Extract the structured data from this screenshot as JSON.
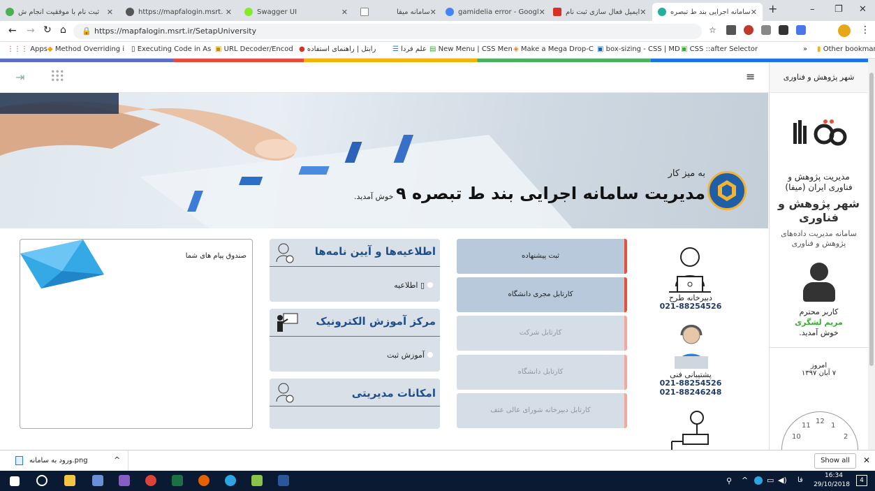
{
  "browser": {
    "tabs": [
      "ثبت نام با موفقیت انجام ش",
      "https://mapfalogin.msrt.",
      "Swagger UI",
      "",
      "سامانه میفا",
      "gamidelia error - Googl",
      "ایمیل فعال سازی ثبت نام",
      "سامانه اجرایی بند ط تبصره"
    ],
    "url": "https://mapfalogin.msrt.ir/SetapUniversity",
    "bookmarks": [
      "Apps",
      "Method Overriding i",
      "Executing Code in As",
      "URL Decoder/Encod",
      "رابتل | راهنمای استفاده",
      "علم فردا",
      "New Menu | CSS Men",
      "Make a Mega Drop-C",
      "box-sizing - CSS | MD",
      "CSS ::after Selector",
      "»",
      "Other bookmarks"
    ]
  },
  "sidebar": {
    "header": "شهر پژوهش و فناوری",
    "org": "مدیریت پژوهش و فناوری ایران (میفا)",
    "city": "شهر پژوهش و فناوری",
    "system": "سامانه مدیریت داده‌های پژوهش و فناوری",
    "user_greeting": "کاربر محترم",
    "user_name": "مریم لشگری",
    "welcome": "خوش آمدید.",
    "today_label": "امروز",
    "date": "۷ آبان ۱۳۹۷",
    "clock": {
      "n12": "12",
      "n1": "1",
      "n2": "2",
      "n10": "10",
      "n11": "11"
    }
  },
  "hero": {
    "to_desk": "به میز کار",
    "title": "مدیریت سامانه اجرایی بند ط تبصره ۹",
    "welcome": "خوش آمدید."
  },
  "contacts": [
    {
      "label": "دبیرخانه طرح",
      "phone": "021-88254526"
    },
    {
      "label": "پشتیبانی فنی",
      "phone": "021-88254526",
      "phone2": "021-88246248"
    }
  ],
  "menu": [
    {
      "label": "ثبت پیشنهاده",
      "enabled": true
    },
    {
      "label": "کارتابل مجری دانشگاه",
      "enabled": true
    },
    {
      "label": "کارتابل شرکت",
      "enabled": false
    },
    {
      "label": "کارتابل دانشگاه",
      "enabled": false
    },
    {
      "label": "کارتابل دبیرخانه شورای عالی عتف",
      "enabled": false
    }
  ],
  "news": {
    "title": "اطلاعیه‌ها و آیین نامه‌ها",
    "item": "اطلاعیه"
  },
  "elearning": {
    "title": "مرکز آموزش الکترونیک",
    "item": "آموزش ثبت"
  },
  "admin": {
    "title": "امکانات مدیریتی"
  },
  "inbox": {
    "title": "صندوق پیام های شما"
  },
  "downloads": {
    "file": "ورود به سامانه.png",
    "show_all": "Show all"
  },
  "taskbar": {
    "time": "16:34",
    "date": "29/10/2018",
    "lang": "فا"
  },
  "colors": {
    "accent": "#e2533d",
    "active_btn": "#b7c9da",
    "disabled_btn": "#d5dee6",
    "panel": "#d9e0e7",
    "user_green": "#3aaa35"
  }
}
